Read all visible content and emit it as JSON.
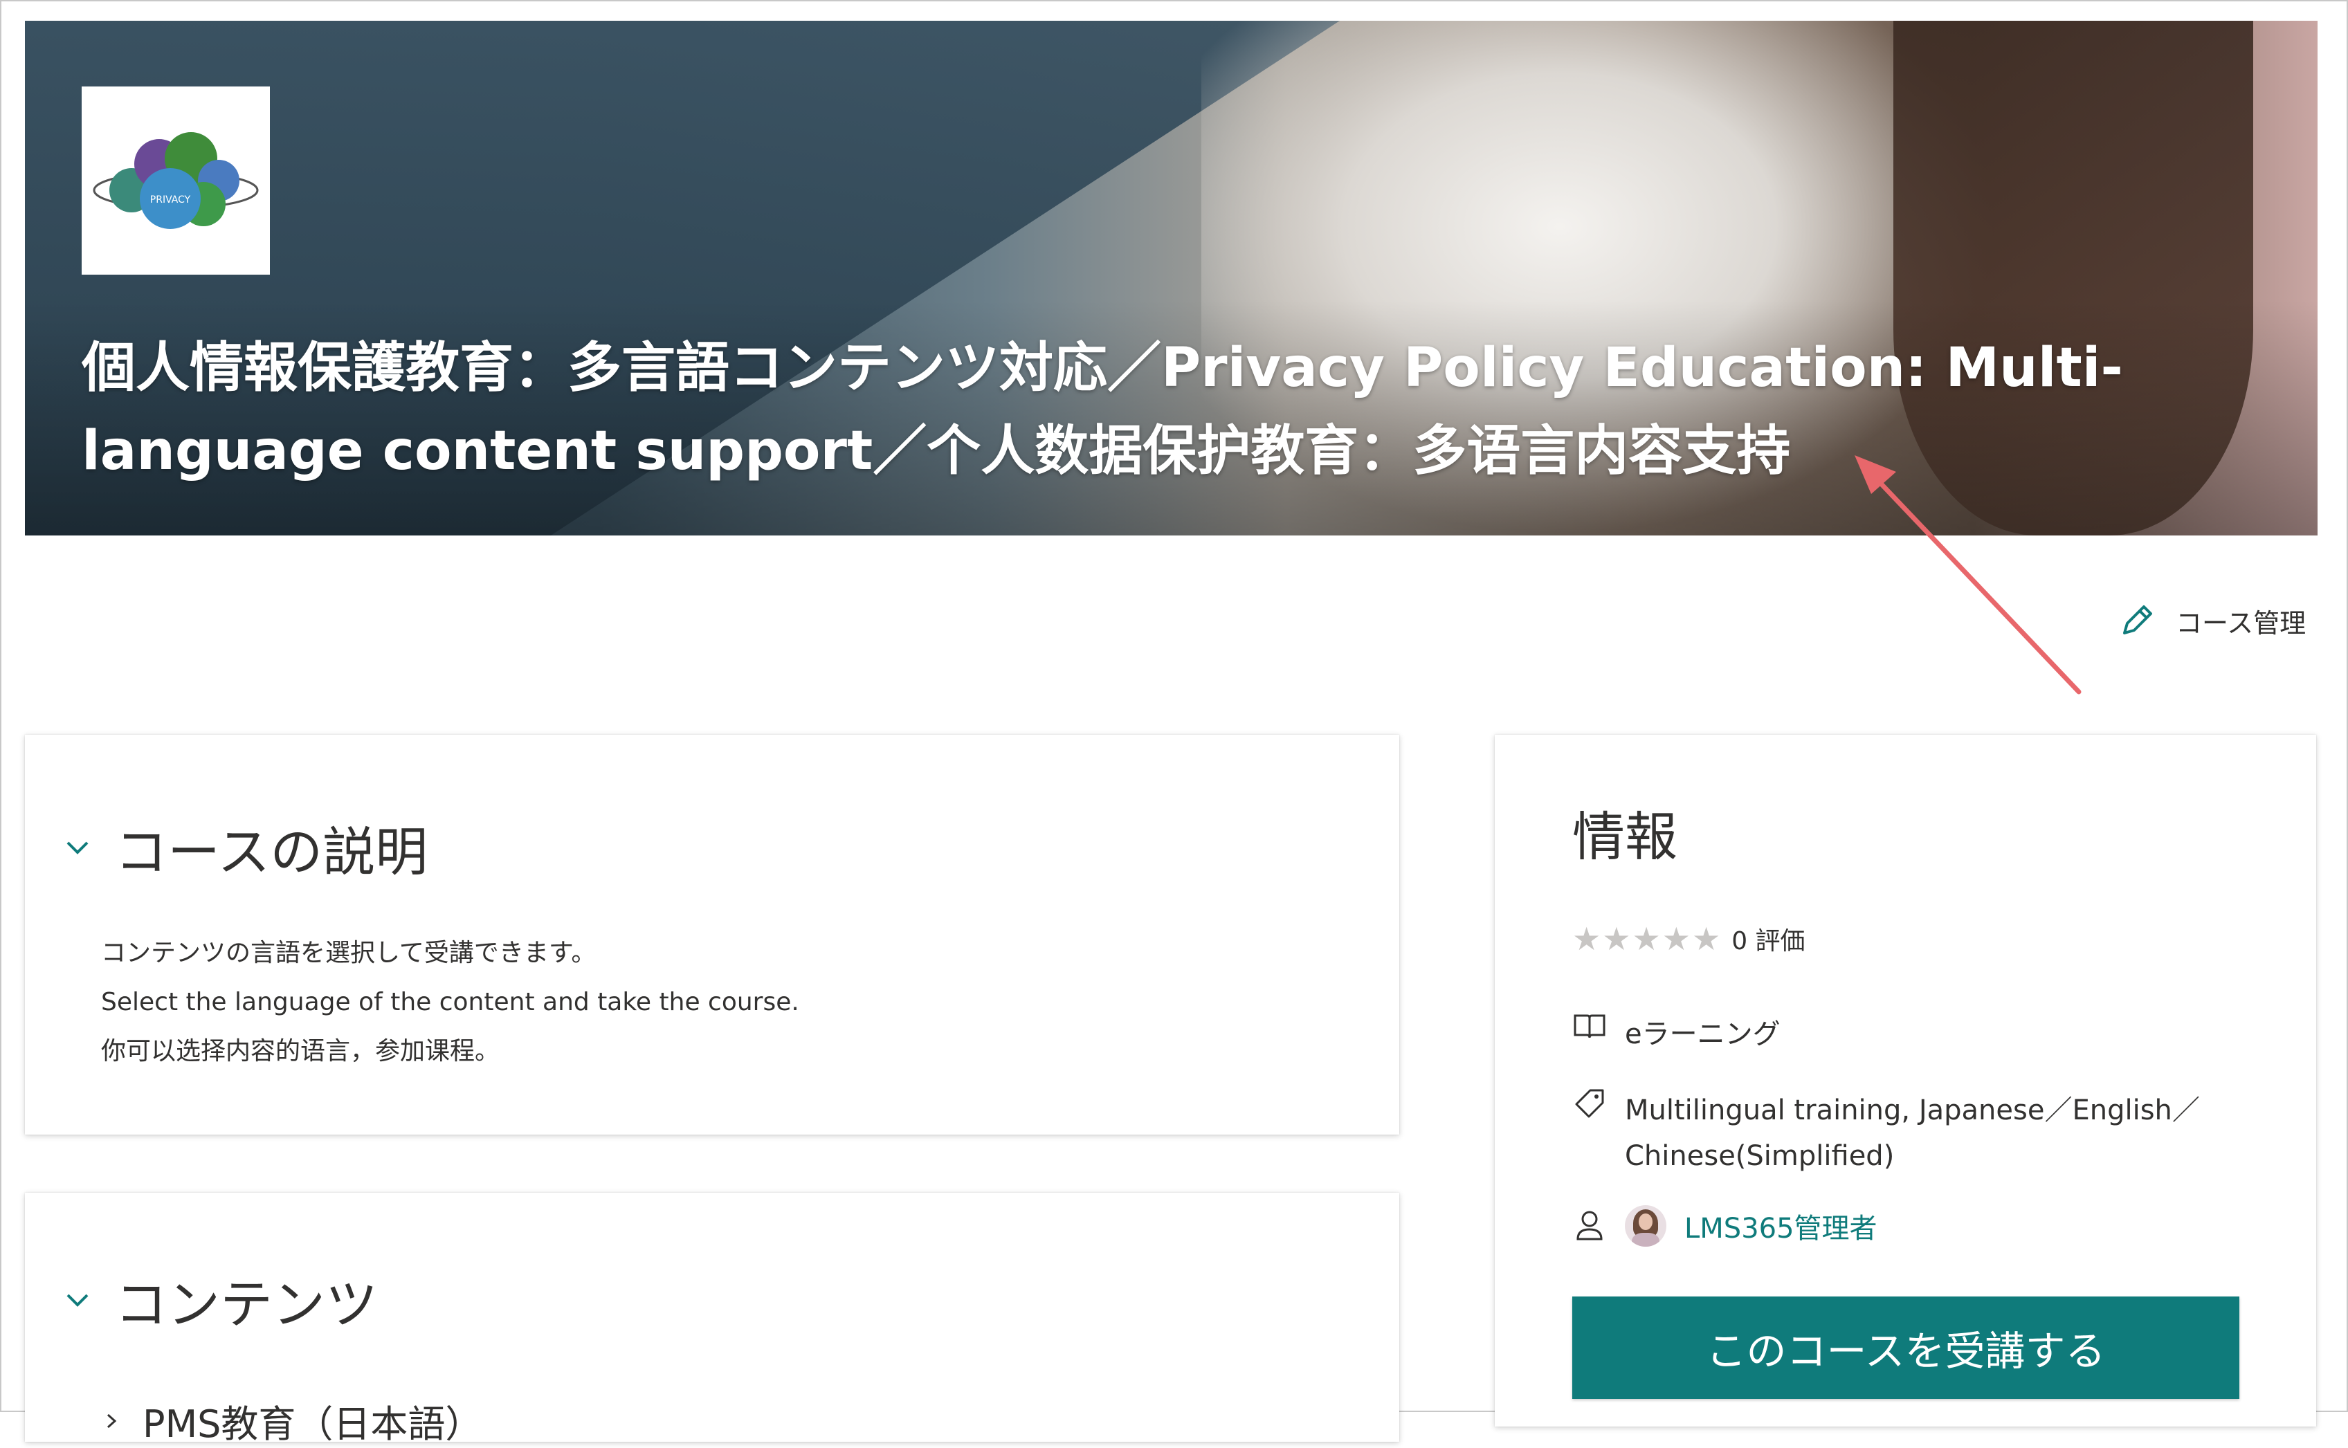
{
  "banner": {
    "title_line1": "個人情報保護教育：多言語コンテンツ対応／Privacy Policy Education: Multi-",
    "title_line2": "language content support／个人数据保护教育：多语言内容支持",
    "logo_label": "PRIVACY"
  },
  "toolbar": {
    "manage_label": "コース管理"
  },
  "description_section": {
    "title": "コースの説明",
    "lines": [
      "コンテンツの言語を選択して受講できます。",
      "Select the language of the content and take the course.",
      "你可以选择内容的语言，参加课程。"
    ]
  },
  "content_section": {
    "title": "コンテンツ",
    "first_item": "PMS教育（日本語）"
  },
  "info": {
    "title": "情報",
    "stars": "★★★★★",
    "rating_count": "0 評価",
    "type": "eラーニング",
    "tags": "Multilingual training, Japanese／English／",
    "tags_line2": "Chinese(Simplified)",
    "owner": "LMS365管理者",
    "enroll_label": "このコースを受講する"
  },
  "colors": {
    "accent": "#0f7b7b",
    "annotation_arrow": "#e8676b"
  }
}
